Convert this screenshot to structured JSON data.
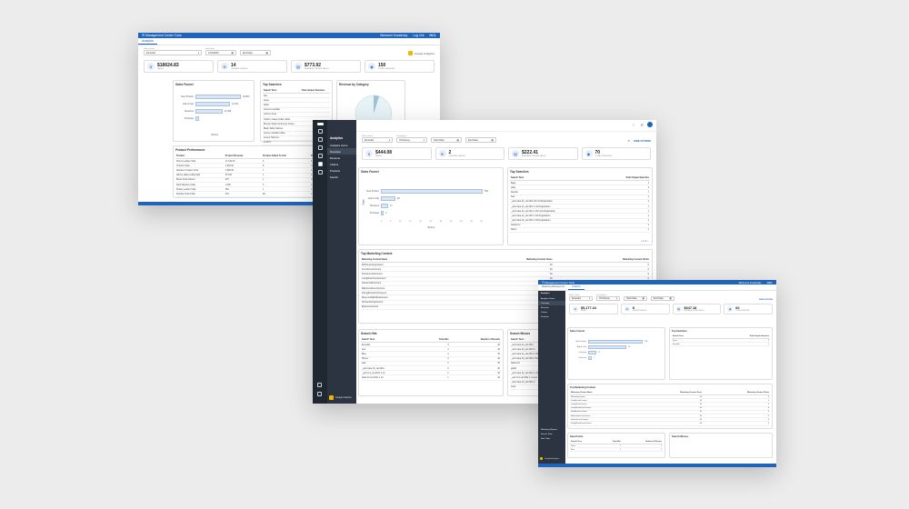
{
  "back": {
    "title": "Management Center Tools",
    "account": "Welcome Kossinsky",
    "logout": "Log Out",
    "brand": "HCL",
    "tab": "Analytics",
    "filters": [
      {
        "label": "Select Store",
        "value": "Emerald"
      },
      {
        "label": "Start Date",
        "value": "12/1/2020"
      },
      {
        "label": "",
        "value": "End Date"
      }
    ],
    "ga": "Google Analytics",
    "cards": [
      {
        "value": "$18624.83",
        "label": "Sales"
      },
      {
        "value": "14",
        "label": "Orders Placed"
      },
      {
        "value": "$773.92",
        "label": "Average Order Value"
      },
      {
        "value": "150",
        "label": "Total Sessions"
      }
    ],
    "funnel_title": "Sales Funnel",
    "funnel_rows": [
      {
        "label": "View Product",
        "value": "19,800"
      },
      {
        "label": "Add to Cart",
        "value": "14,371"
      },
      {
        "label": "Checkout",
        "value": "11,405"
      },
      {
        "label": "Purchase",
        "value": ""
      }
    ],
    "funnel_axis": "Visitors",
    "top_searches_title": "Top Searches",
    "top_searches_cols": [
      "Search Term",
      "Total Unique Searches"
    ],
    "top_searches": [
      "dell",
      "dress",
      "tablet",
      "womens sandals",
      "women dress",
      "Uniform Glass Coffee Table",
      "Brunter Shelf Continuum Amber",
      "Black Table Cabinet",
      "women sandals coffee",
      "Accent Hammer",
      "vu Fil 5"
    ],
    "revenue_title": "Revenue by Category",
    "product_title": "Product Performance",
    "product_cols": [
      "Product",
      "Product Revenue",
      "Product Added To Cart",
      "Product Removed From Cart",
      "Product Check"
    ],
    "products": [
      [
        "Prinny Leather Sofa",
        "17,140.00",
        "4",
        "1",
        "1"
      ],
      [
        "Thandro Sofa",
        "2,230.00",
        "8",
        "3",
        "1"
      ],
      [
        "Wooden Coaster Chair",
        "2,380.00",
        "1",
        "1",
        "1"
      ],
      [
        "adrone glass ceiling light",
        "374.00",
        "1",
        "1",
        "1"
      ],
      [
        "Brass Sofa Cabinet",
        "975",
        "1",
        "3",
        "1"
      ],
      [
        "Dark Wooden Chair",
        "1,200",
        "2",
        "1",
        "1"
      ],
      [
        "Prairie Leather Sofa",
        "360",
        "1",
        "1",
        "1"
      ],
      [
        "Wooden Sofa Chair",
        "379",
        "66",
        "1",
        "1"
      ]
    ]
  },
  "main": {
    "header": "Analytics",
    "nav": [
      "Analytics Home",
      "Overview",
      "Revenue",
      "Visitors",
      "Products",
      "Search"
    ],
    "ga_footer": "Google Analytics",
    "filters": [
      {
        "label": "Select Store",
        "value": "Emerald"
      },
      {
        "label": "Campaigns",
        "value": "US Dense"
      },
      {
        "label": "",
        "value": "Start Date"
      },
      {
        "label": "",
        "value": "End Date"
      }
    ],
    "hide_filters": "HIDE FILTERS",
    "cards": [
      {
        "value": "$444.08",
        "label": "Sales"
      },
      {
        "value": "2",
        "label": "Orders Placed"
      },
      {
        "value": "$222.41",
        "label": "Average Order Value"
      },
      {
        "value": "70",
        "label": "Total Sessions"
      }
    ],
    "funnel_title": "Sales Funnel",
    "funnel_rows": [
      {
        "label": "View Product",
        "value": "564"
      },
      {
        "label": "Add to Cart",
        "value": "83"
      },
      {
        "label": "Checkout",
        "value": "17"
      },
      {
        "label": "Purchase",
        "value": "2"
      }
    ],
    "funnel_ticks": [
      "0",
      "5",
      "10",
      "15",
      "20",
      "25",
      "30",
      "35",
      "40",
      "45",
      "50"
    ],
    "funnel_axis": "Visitors",
    "funnel_ylabel": "Steps",
    "top_searches_title": "Top Searches",
    "top_searches_cols": [
      "Search Term",
      "Total Unique Searches"
    ],
    "top_searches": [
      [
        "Bags",
        "1"
      ],
      [
        "table",
        "1"
      ],
      [
        "blender",
        "1"
      ],
      [
        "Sell",
        "1"
      ],
      [
        "_upint aka 14_cat 2011 10 List:Registration",
        "1"
      ],
      [
        "_upint aka 14_cat 2011 1 14 Registration",
        "1"
      ],
      [
        "_upint aka 14_cat 2011 1 20 Lists Registration",
        "1"
      ],
      [
        "_upint aka 14_cat 2011 1 20 Registration",
        "1"
      ],
      [
        "_upint aka 14_cat 2011 1 20 Registration",
        "1"
      ],
      [
        "backcorer",
        "1"
      ],
      [
        "blazer",
        "1"
      ]
    ],
    "pager": "1 / 2",
    "marketing_title": "Top Marketing Content",
    "marketing_cols": [
      "Marketing Content Name",
      "Marketing Content Views",
      "Marketing Content Clicks"
    ],
    "marketing": [
      [
        "AllHomeLivingContent",
        "40",
        "0"
      ],
      [
        "FurniAccentContent",
        "40",
        "0"
      ],
      [
        "HomeFurnishContent",
        "40",
        "0"
      ],
      [
        "LivingRoomFurniContent",
        "40",
        "0"
      ],
      [
        "NewArrivalsContent",
        "40",
        "0"
      ],
      [
        "BathroomDecorContent",
        "40",
        "0"
      ],
      [
        "DiningRoomFurniContent",
        "40",
        "0"
      ],
      [
        "PlayroomBathMetaContent",
        "40",
        "0"
      ],
      [
        "KitchenDiningContent",
        "40",
        "0"
      ],
      [
        "BedroomContent",
        "40",
        "0"
      ]
    ],
    "hits_title": "Search Hits",
    "hits_cols": [
      "Search Term",
      "Total Hits",
      "Number of Results"
    ],
    "hits": [
      [
        "Emerald",
        "4",
        "40"
      ],
      [
        "bed",
        "4",
        "40"
      ],
      [
        "Blue",
        "3",
        "40"
      ],
      [
        "Shoes",
        "3",
        "40"
      ],
      [
        "sale",
        "2",
        "40"
      ],
      [
        "_upint aka 14_cat 2011",
        "2",
        "40"
      ],
      [
        "_upint 14_cat 2011 1 14",
        "2",
        "40"
      ],
      [
        "table 24 cat 2011 1 14",
        "1",
        "40"
      ]
    ],
    "misses_title": "Search Misses",
    "misses_cols": [
      "Search Term"
    ],
    "misses": [
      "_upint aka 14_cat 2011",
      "_upint aka 14_cat 2011 1",
      "_upint aka 14_cat 2011 1 15",
      "_upint aka 14_cat 2011 1 Registration",
      "bathroom",
      "guilds",
      "_upint aka 14_cat 2011 1 14",
      "_upint 14 cat 2011 1 4 Lists",
      "_upint aka 14_cat 2011 1",
      "order"
    ]
  },
  "front": {
    "title": "Management Center Tools",
    "account": "Welcome Kossinsky",
    "brand": "HCL",
    "tabs": [
      "Marketing Management",
      "Analytics"
    ],
    "nav": [
      "Analytics",
      "Analytics Home",
      "Overview",
      "Revenue",
      "Visitors",
      "Products"
    ],
    "nav_bottom": [
      "Marketing Reports",
      "Search Tools",
      "Sort Order"
    ],
    "filters": [
      {
        "label": "Select Store",
        "value": "Emerald"
      },
      {
        "label": "Campaigns",
        "value": "US Dense"
      },
      {
        "label": "",
        "value": "Start Date"
      },
      {
        "label": "",
        "value": "End Date"
      }
    ],
    "hide_filters": "HIDE FILTERS",
    "cards": [
      {
        "value": "$5,177.44",
        "label": "Sales"
      },
      {
        "value": "8",
        "label": "Orders Placed"
      },
      {
        "value": "$647.18",
        "label": "Average Order Value"
      },
      {
        "value": "60",
        "label": "Total Sessions"
      }
    ],
    "funnel_title": "Sales Funnel",
    "funnel_rows": [
      {
        "label": "View Product",
        "value": "108"
      },
      {
        "label": "Add to Cart",
        "value": "76"
      },
      {
        "label": "Checkout",
        "value": "15"
      },
      {
        "label": "Purchase",
        "value": "7"
      }
    ],
    "top_searches_title": "Top Searches",
    "top_searches_cols": [
      "Search Term",
      "Total Unique Searches"
    ],
    "top_searches": [
      [
        "Dress",
        "1"
      ],
      [
        "tile table",
        "1"
      ]
    ],
    "marketing_title": "Top Marketing Content",
    "marketing_cols": [
      "Marketing Content Name",
      "Marketing Content Views",
      "Marketing Content Clicks"
    ],
    "marketing": [
      [
        "MarketingContent",
        "40",
        "0"
      ],
      [
        "FurniAccentContent",
        "40",
        "0"
      ],
      [
        "LivingRoomContent",
        "40",
        "0"
      ],
      [
        "LivingRoomFurniContent",
        "40",
        "0"
      ],
      [
        "NewArrivalsContent",
        "40",
        "0"
      ],
      [
        "BathroomDecorContent",
        "40",
        "0"
      ],
      [
        "HomeFurnishContent",
        "40",
        "0"
      ],
      [
        "DiningRoomFurniContent",
        "40",
        "0"
      ]
    ],
    "hits_title": "Search Hits",
    "hits_cols": [
      "Search Term",
      "Total Hits",
      "Number of Results"
    ],
    "hits": [
      [
        "Dress",
        "1",
        "1"
      ],
      [
        "Blue",
        "1",
        "1"
      ]
    ],
    "misses_title": "Search Misses",
    "ga_footer": "Google Analytics"
  }
}
